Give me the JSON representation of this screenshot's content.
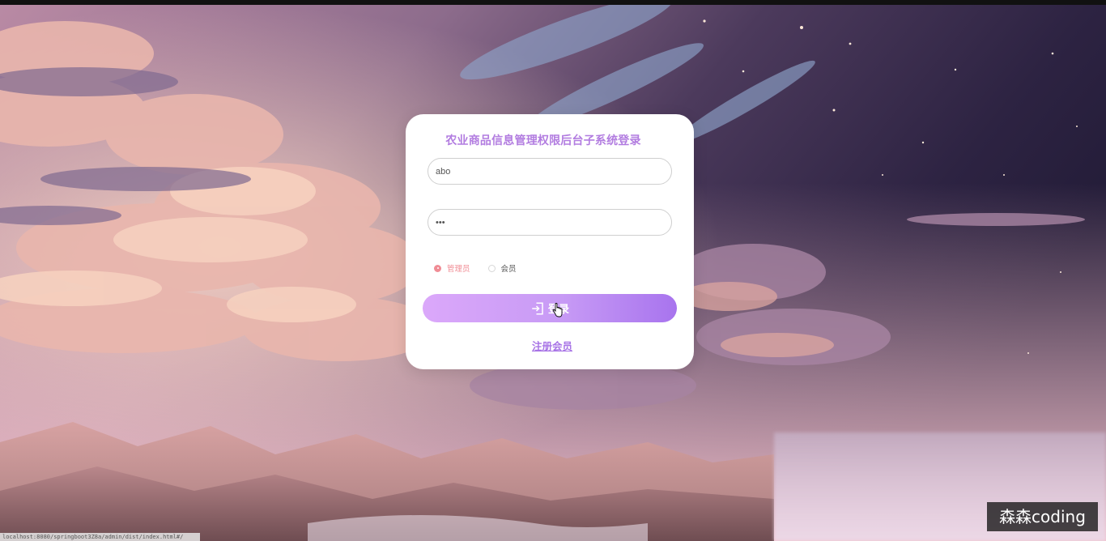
{
  "login": {
    "title": "农业商品信息管理权限后台子系统登录",
    "username_value": "abo",
    "password_mask": "•••",
    "roles": [
      {
        "label": "管理员",
        "selected": true
      },
      {
        "label": "会员",
        "selected": false
      }
    ],
    "login_label": "登录",
    "register_label": "注册会员"
  },
  "overlay": {
    "watermark": "森森coding",
    "status_url": "localhost:8080/springboot3Z8a/admin/dist/index.html#/"
  },
  "colors": {
    "accent": "#b27ce0",
    "button_gradient_start": "#dba8fa",
    "button_gradient_end": "#a874ee",
    "radio_selected": "#f08c95"
  },
  "icons": {
    "login_button": "login-enter-icon",
    "cursor": "hand-pointer-icon"
  }
}
